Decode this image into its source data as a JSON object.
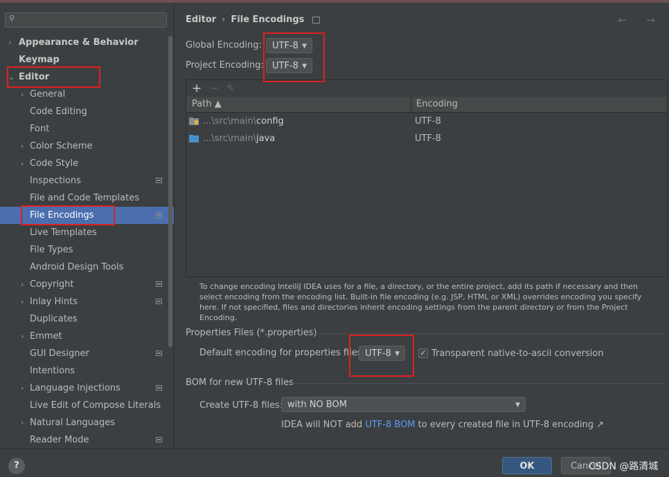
{
  "sidebar": {
    "search_placeholder": "",
    "items": [
      {
        "label": "Appearance & Behavior",
        "arrow": "›"
      },
      {
        "label": "Keymap",
        "arrow": ""
      },
      {
        "label": "Editor",
        "arrow": "⌄"
      },
      {
        "label": "General",
        "arrow": "›"
      },
      {
        "label": "Code Editing",
        "arrow": ""
      },
      {
        "label": "Font",
        "arrow": ""
      },
      {
        "label": "Color Scheme",
        "arrow": "›"
      },
      {
        "label": "Code Style",
        "arrow": "›"
      },
      {
        "label": "Inspections",
        "arrow": ""
      },
      {
        "label": "File and Code Templates",
        "arrow": ""
      },
      {
        "label": "File Encodings",
        "arrow": ""
      },
      {
        "label": "Live Templates",
        "arrow": ""
      },
      {
        "label": "File Types",
        "arrow": ""
      },
      {
        "label": "Android Design Tools",
        "arrow": ""
      },
      {
        "label": "Copyright",
        "arrow": "›"
      },
      {
        "label": "Inlay Hints",
        "arrow": "›"
      },
      {
        "label": "Duplicates",
        "arrow": ""
      },
      {
        "label": "Emmet",
        "arrow": "›"
      },
      {
        "label": "GUI Designer",
        "arrow": ""
      },
      {
        "label": "Intentions",
        "arrow": ""
      },
      {
        "label": "Language Injections",
        "arrow": "›"
      },
      {
        "label": "Live Edit of Compose Literals",
        "arrow": ""
      },
      {
        "label": "Natural Languages",
        "arrow": "›"
      },
      {
        "label": "Reader Mode",
        "arrow": ""
      }
    ]
  },
  "header": {
    "breadcrumb_parent": "Editor",
    "breadcrumb_sep": "›",
    "breadcrumb_current": "File Encodings",
    "nav": "← →"
  },
  "encoding": {
    "global_label": "Global Encoding:",
    "global_value": "UTF-8",
    "project_label": "Project Encoding:",
    "project_value": "UTF-8"
  },
  "toolbar": {
    "add": "+",
    "remove": "−",
    "edit": "✎"
  },
  "table": {
    "col_path": "Path ▲",
    "col_encoding": "Encoding",
    "rows": [
      {
        "prefix": "...\\src\\main\\",
        "name": "config",
        "encoding": "UTF-8"
      },
      {
        "prefix": "...\\src\\main\\",
        "name": "java",
        "encoding": "UTF-8"
      }
    ]
  },
  "help_text": "To change encoding IntelliJ IDEA uses for a file, a directory, or the entire project, add its path if necessary and then select encoding from the encoding list. Built-in file encoding (e.g. JSP, HTML or XML) overrides encoding you specify here. If not specified, files and directories inherit encoding settings from the parent directory or from the Project Encoding.",
  "properties": {
    "section": "Properties Files (*.properties)",
    "default_label": "Default encoding for properties files:",
    "default_value": "UTF-8",
    "transparent_label": "Transparent native-to-ascii conversion",
    "transparent_checked": "✓"
  },
  "bom": {
    "section": "BOM for new UTF-8 files",
    "create_label": "Create UTF-8 files:",
    "create_value": "with NO BOM",
    "note_pre": "IDEA will NOT add ",
    "note_link": "UTF-8 BOM",
    "note_post": " to every created file in UTF-8 encoding ↗"
  },
  "footer": {
    "help": "?",
    "ok": "OK",
    "cancel": "Cancel",
    "watermark": "CSDN @路清城"
  },
  "colors": {
    "selection": "#4b6eaf",
    "highlight_box": "#e02020",
    "link": "#589df6"
  }
}
